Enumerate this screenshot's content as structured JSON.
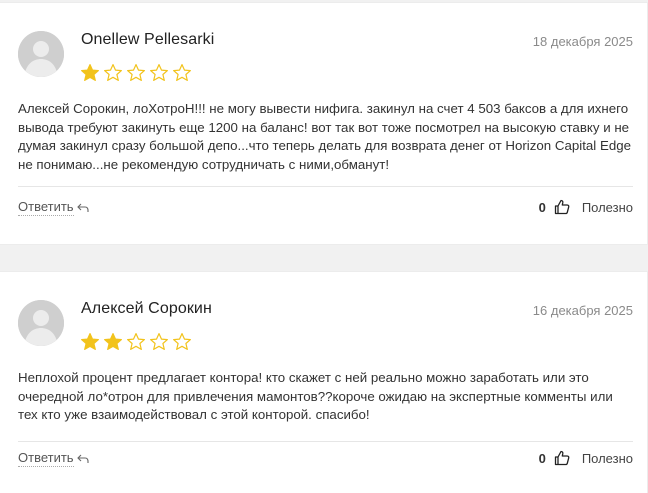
{
  "colors": {
    "star": "#f2c31c",
    "avatar": "#cfcfcf",
    "date": "#8a8a8a"
  },
  "reviews": [
    {
      "author": "Onellew Pellesarki",
      "date": "18 декабря 2025",
      "rating": 1,
      "max_rating": 5,
      "text": "Алексей Сорокин, лоХотроН!!! не могу вывести нифига. закинул на счет 4 503 баксов а для ихнего вывода требуют закинуть еще 1200 на баланс! вот так вот тоже посмотрел на высокую ставку и не думая закинул сразу большой депо...что теперь делать для возврата денег от Horizon Capital Edge не понимаю...не рекомендую сотрудничать с ними,обманут!",
      "reply_label": "Ответить",
      "likes": "0",
      "useful_label": "Полезно"
    },
    {
      "author": "Алексей Сорокин",
      "date": "16 декабря 2025",
      "rating": 2,
      "max_rating": 5,
      "text": "Неплохой процент предлагает контора! кто скажет с ней реально можно заработать или это очередной ло*отрон для привлечения мамонтов??короче ожидаю на экспертные комменты или тех кто уже взаимодействовал с этой конторой. спасибо!",
      "reply_label": "Ответить",
      "likes": "0",
      "useful_label": "Полезно"
    }
  ]
}
